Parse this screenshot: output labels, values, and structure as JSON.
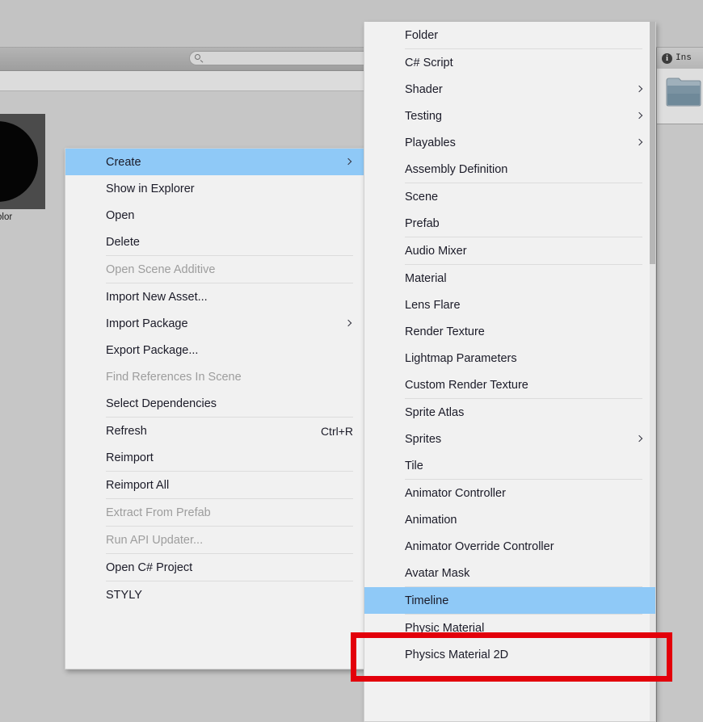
{
  "app": {
    "name": "Unity Editor",
    "window_background": "#c6c6c6"
  },
  "colors": {
    "menu_background": "#f1f1f1",
    "menu_highlight": "#8fc9f7",
    "menu_text": "#1b1b28",
    "menu_text_disabled": "#9d9d9d",
    "separator": "#dcdcdc",
    "annotation_red": "#e3000b"
  },
  "project_panel": {
    "search": {
      "icon": "search-icon",
      "value": "",
      "placeholder": ""
    },
    "asset": {
      "label": "leColor",
      "thumbnail": "sphere-material-preview"
    }
  },
  "inspector": {
    "info_icon": "info-icon",
    "tab_label": "Ins",
    "content_icon": "folder-icon"
  },
  "context_menu": {
    "name": "project-context-menu",
    "groups": [
      {
        "items": [
          {
            "label": "Create",
            "submenu": true,
            "highlighted": true,
            "disabled": false,
            "shortcut": ""
          },
          {
            "label": "Show in Explorer",
            "submenu": false,
            "highlighted": false,
            "disabled": false,
            "shortcut": ""
          },
          {
            "label": "Open",
            "submenu": false,
            "highlighted": false,
            "disabled": false,
            "shortcut": ""
          },
          {
            "label": "Delete",
            "submenu": false,
            "highlighted": false,
            "disabled": false,
            "shortcut": ""
          }
        ]
      },
      {
        "items": [
          {
            "label": "Open Scene Additive",
            "submenu": false,
            "highlighted": false,
            "disabled": true,
            "shortcut": ""
          }
        ]
      },
      {
        "items": [
          {
            "label": "Import New Asset...",
            "submenu": false,
            "highlighted": false,
            "disabled": false,
            "shortcut": ""
          },
          {
            "label": "Import Package",
            "submenu": true,
            "highlighted": false,
            "disabled": false,
            "shortcut": ""
          },
          {
            "label": "Export Package...",
            "submenu": false,
            "highlighted": false,
            "disabled": false,
            "shortcut": ""
          },
          {
            "label": "Find References In Scene",
            "submenu": false,
            "highlighted": false,
            "disabled": true,
            "shortcut": ""
          },
          {
            "label": "Select Dependencies",
            "submenu": false,
            "highlighted": false,
            "disabled": false,
            "shortcut": ""
          }
        ]
      },
      {
        "items": [
          {
            "label": "Refresh",
            "submenu": false,
            "highlighted": false,
            "disabled": false,
            "shortcut": "Ctrl+R"
          },
          {
            "label": "Reimport",
            "submenu": false,
            "highlighted": false,
            "disabled": false,
            "shortcut": ""
          }
        ]
      },
      {
        "items": [
          {
            "label": "Reimport All",
            "submenu": false,
            "highlighted": false,
            "disabled": false,
            "shortcut": ""
          }
        ]
      },
      {
        "items": [
          {
            "label": "Extract From Prefab",
            "submenu": false,
            "highlighted": false,
            "disabled": true,
            "shortcut": ""
          }
        ]
      },
      {
        "items": [
          {
            "label": "Run API Updater...",
            "submenu": false,
            "highlighted": false,
            "disabled": true,
            "shortcut": ""
          }
        ]
      },
      {
        "items": [
          {
            "label": "Open C# Project",
            "submenu": false,
            "highlighted": false,
            "disabled": false,
            "shortcut": ""
          }
        ]
      },
      {
        "items": [
          {
            "label": "STYLY",
            "submenu": false,
            "highlighted": false,
            "disabled": false,
            "shortcut": ""
          }
        ]
      }
    ]
  },
  "create_submenu": {
    "name": "create-submenu",
    "groups": [
      {
        "items": [
          {
            "label": "Folder",
            "submenu": false,
            "highlighted": false,
            "disabled": false,
            "shortcut": ""
          }
        ]
      },
      {
        "items": [
          {
            "label": "C# Script",
            "submenu": false,
            "highlighted": false,
            "disabled": false,
            "shortcut": ""
          },
          {
            "label": "Shader",
            "submenu": true,
            "highlighted": false,
            "disabled": false,
            "shortcut": ""
          },
          {
            "label": "Testing",
            "submenu": true,
            "highlighted": false,
            "disabled": false,
            "shortcut": ""
          },
          {
            "label": "Playables",
            "submenu": true,
            "highlighted": false,
            "disabled": false,
            "shortcut": ""
          },
          {
            "label": "Assembly Definition",
            "submenu": false,
            "highlighted": false,
            "disabled": false,
            "shortcut": ""
          }
        ]
      },
      {
        "items": [
          {
            "label": "Scene",
            "submenu": false,
            "highlighted": false,
            "disabled": false,
            "shortcut": ""
          },
          {
            "label": "Prefab",
            "submenu": false,
            "highlighted": false,
            "disabled": false,
            "shortcut": ""
          }
        ]
      },
      {
        "items": [
          {
            "label": "Audio Mixer",
            "submenu": false,
            "highlighted": false,
            "disabled": false,
            "shortcut": ""
          }
        ]
      },
      {
        "items": [
          {
            "label": "Material",
            "submenu": false,
            "highlighted": false,
            "disabled": false,
            "shortcut": ""
          },
          {
            "label": "Lens Flare",
            "submenu": false,
            "highlighted": false,
            "disabled": false,
            "shortcut": ""
          },
          {
            "label": "Render Texture",
            "submenu": false,
            "highlighted": false,
            "disabled": false,
            "shortcut": ""
          },
          {
            "label": "Lightmap Parameters",
            "submenu": false,
            "highlighted": false,
            "disabled": false,
            "shortcut": ""
          },
          {
            "label": "Custom Render Texture",
            "submenu": false,
            "highlighted": false,
            "disabled": false,
            "shortcut": ""
          }
        ]
      },
      {
        "items": [
          {
            "label": "Sprite Atlas",
            "submenu": false,
            "highlighted": false,
            "disabled": false,
            "shortcut": ""
          },
          {
            "label": "Sprites",
            "submenu": true,
            "highlighted": false,
            "disabled": false,
            "shortcut": ""
          },
          {
            "label": "Tile",
            "submenu": false,
            "highlighted": false,
            "disabled": false,
            "shortcut": ""
          }
        ]
      },
      {
        "items": [
          {
            "label": "Animator Controller",
            "submenu": false,
            "highlighted": false,
            "disabled": false,
            "shortcut": ""
          },
          {
            "label": "Animation",
            "submenu": false,
            "highlighted": false,
            "disabled": false,
            "shortcut": ""
          },
          {
            "label": "Animator Override Controller",
            "submenu": false,
            "highlighted": false,
            "disabled": false,
            "shortcut": ""
          },
          {
            "label": "Avatar Mask",
            "submenu": false,
            "highlighted": false,
            "disabled": false,
            "shortcut": ""
          }
        ]
      },
      {
        "items": [
          {
            "label": "Timeline",
            "submenu": false,
            "highlighted": true,
            "disabled": false,
            "shortcut": ""
          }
        ]
      },
      {
        "items": [
          {
            "label": "Physic Material",
            "submenu": false,
            "highlighted": false,
            "disabled": false,
            "shortcut": ""
          },
          {
            "label": "Physics Material 2D",
            "submenu": false,
            "highlighted": false,
            "disabled": false,
            "shortcut": ""
          }
        ]
      }
    ]
  },
  "annotation": {
    "name": "timeline-highlight-box",
    "target": "Timeline",
    "color": "#e3000b"
  }
}
